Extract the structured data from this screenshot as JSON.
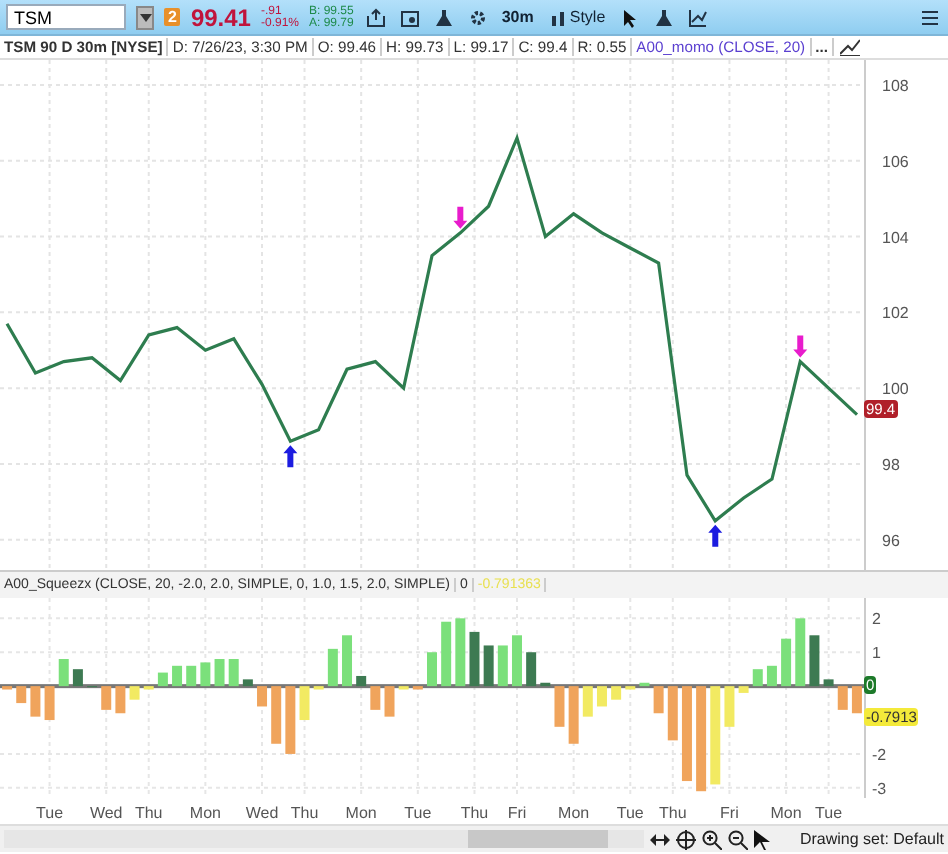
{
  "toolbar": {
    "symbol": "TSM",
    "badge": "2",
    "last": "99.41",
    "change": "-.91",
    "change_pct": "-0.91%",
    "bid": "B: 99.55",
    "ask": "A: 99.79",
    "interval": "30m",
    "style": "Style"
  },
  "info_bar": {
    "title": "TSM 90 D 30m [NYSE]",
    "fields": [
      "D: 7/26/23, 3:30 PM",
      "O: 99.46",
      "H: 99.73",
      "L: 99.17",
      "C: 99.4",
      "R: 0.55"
    ],
    "study": "A00_momo (CLOSE, 20)",
    "more": "..."
  },
  "price_chart": {
    "last_label": "99.4",
    "chart_data": {
      "type": "line",
      "series": [
        {
          "color": "#2e7d4f",
          "values": [
            101.7,
            100.4,
            100.7,
            100.8,
            100.2,
            101.4,
            101.6,
            101,
            101.3,
            100.1,
            98.6,
            98.9,
            100.5,
            100.7,
            100,
            103.5,
            104.1,
            104.8,
            106.6,
            104,
            104.6,
            104.1,
            103.7,
            103.3,
            97.7,
            96.5,
            97.1,
            97.6,
            100.7,
            100,
            99.3
          ]
        }
      ],
      "ylim": [
        95.2,
        108.66
      ],
      "yticks": [
        96,
        98,
        100,
        102,
        104,
        106,
        108
      ],
      "grid": true
    },
    "signals": [
      {
        "kind": "up",
        "color": "#1c1ce0"
      },
      {
        "kind": "up",
        "color": "#1c1ce0"
      },
      {
        "kind": "down",
        "color": "#e81ccc"
      },
      {
        "kind": "down",
        "color": "#e81ccc"
      }
    ]
  },
  "indicator": {
    "label": "A00_Squeezx (CLOSE, 20, -2.0, 2.0, SIMPLE, 0, 1.0, 1.5, 2.0, SIMPLE)",
    "value_1": "0",
    "value_2": "-0.791363",
    "zero_label": "0",
    "last_label": "-0.7913",
    "chart_data": {
      "type": "bar",
      "categories": [
        null,
        null,
        null,
        "Tue",
        null,
        null,
        null,
        "Wed",
        null,
        null,
        "Thu",
        null,
        null,
        null,
        "Mon",
        null,
        null,
        null,
        "Wed",
        null,
        null,
        "Thu",
        null,
        null,
        null,
        "Mon",
        null,
        null,
        null,
        "Tue",
        null,
        null,
        null,
        "Thu",
        null,
        null,
        "Fri",
        null,
        null,
        null,
        "Mon",
        null,
        null,
        null,
        "Tue",
        null,
        null,
        "Thu",
        null,
        null,
        null,
        "Fri",
        null,
        null,
        null,
        "Mon",
        null,
        null,
        "Tue",
        null,
        null
      ],
      "series": [
        {
          "values": [
            -0.1,
            -0.5,
            -0.9,
            -1.0,
            0.8,
            0.5,
            0.0,
            -0.7,
            -0.8,
            -0.4,
            -0.1,
            0.4,
            0.6,
            0.6,
            0.7,
            0.8,
            0.8,
            0.2,
            -0.6,
            -1.7,
            -2.0,
            -1.0,
            -0.1,
            1.1,
            1.5,
            0.3,
            -0.7,
            -0.9,
            -0.1,
            -0.1,
            1.0,
            1.9,
            2.0,
            1.6,
            1.2,
            1.2,
            1.5,
            1.0,
            0.1,
            -1.2,
            -1.7,
            -0.9,
            -0.6,
            -0.4,
            -0.1,
            0.1,
            -0.8,
            -1.6,
            -2.8,
            -3.1,
            -2.9,
            -1.2,
            -0.2,
            0.5,
            0.6,
            1.4,
            2.0,
            1.5,
            0.2,
            -0.7,
            -0.8
          ]
        }
      ],
      "ylim": [
        -3.3,
        2.6
      ],
      "yticks": [
        -3,
        -2,
        1,
        2
      ],
      "grid": true
    }
  },
  "status_bar": {
    "drawing_set": "Drawing set: Default"
  }
}
